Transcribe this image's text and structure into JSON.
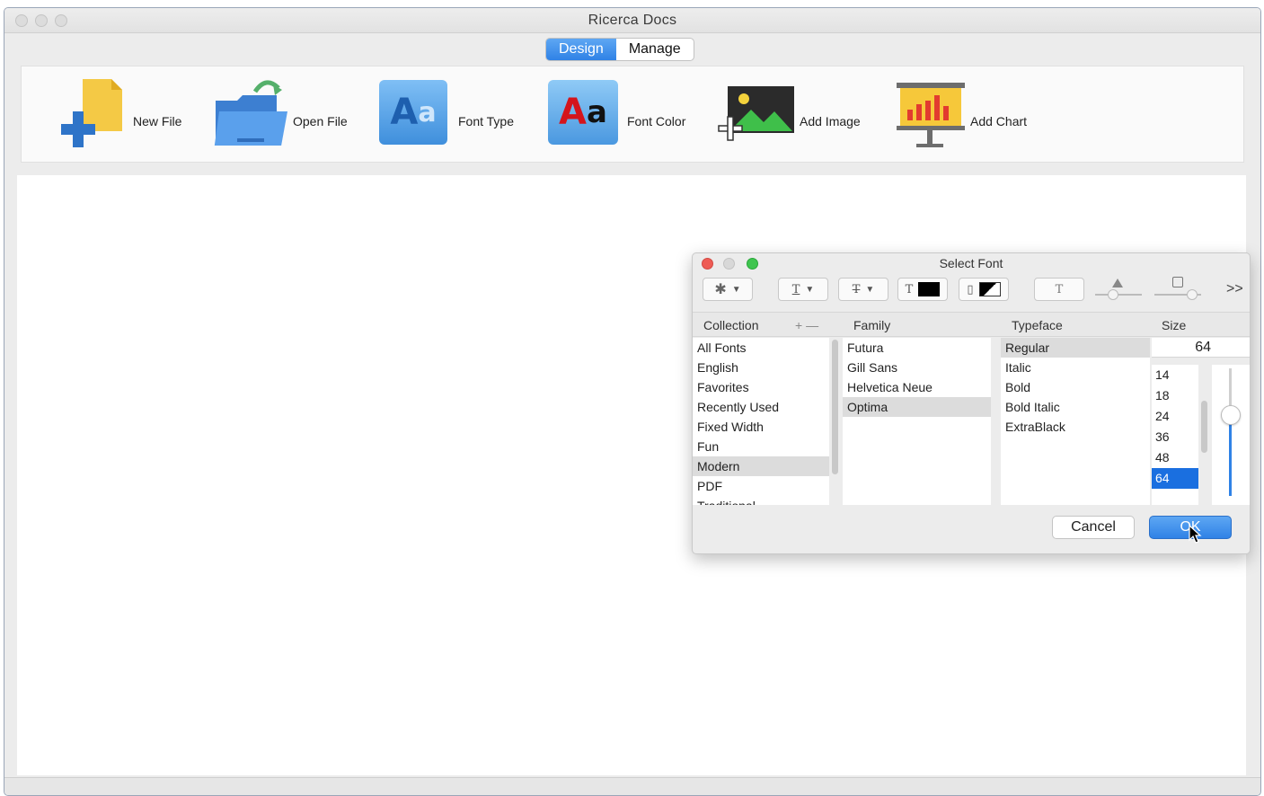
{
  "window": {
    "title": "Ricerca Docs"
  },
  "tabs": [
    {
      "label": "Design",
      "active": true
    },
    {
      "label": "Manage",
      "active": false
    }
  ],
  "toolbar": {
    "items": [
      {
        "label": "New File",
        "icon": "new-file-icon"
      },
      {
        "label": "Open File",
        "icon": "open-folder-icon"
      },
      {
        "label": "Font Type",
        "icon": "font-type-icon"
      },
      {
        "label": "Font Color",
        "icon": "font-color-icon"
      },
      {
        "label": "Add Image",
        "icon": "add-image-icon"
      },
      {
        "label": "Add  Chart",
        "icon": "add-chart-icon"
      }
    ]
  },
  "font_panel": {
    "title": "Select Font",
    "headers": {
      "collection": "Collection",
      "family": "Family",
      "typeface": "Typeface",
      "size": "Size",
      "add_remove": "+ —"
    },
    "collections": [
      "All Fonts",
      "English",
      "Favorites",
      "Recently Used",
      "Fixed Width",
      "Fun",
      "Modern",
      "PDF",
      "Traditional"
    ],
    "selected_collection": "Modern",
    "families": [
      "Futura",
      "Gill Sans",
      "Helvetica Neue",
      "Optima"
    ],
    "selected_family": "Optima",
    "typefaces": [
      "Regular",
      "Italic",
      "Bold",
      "Bold Italic",
      "ExtraBlack"
    ],
    "selected_typeface": "Regular",
    "size_value": "64",
    "sizes": [
      "14",
      "18",
      "24",
      "36",
      "48",
      "64"
    ],
    "selected_size": "64",
    "cancel_label": "Cancel",
    "ok_label": "OK",
    "overflow_label": ">>"
  },
  "colors": {
    "accent": "#2f82e6",
    "selection": "#1a6fe0"
  }
}
